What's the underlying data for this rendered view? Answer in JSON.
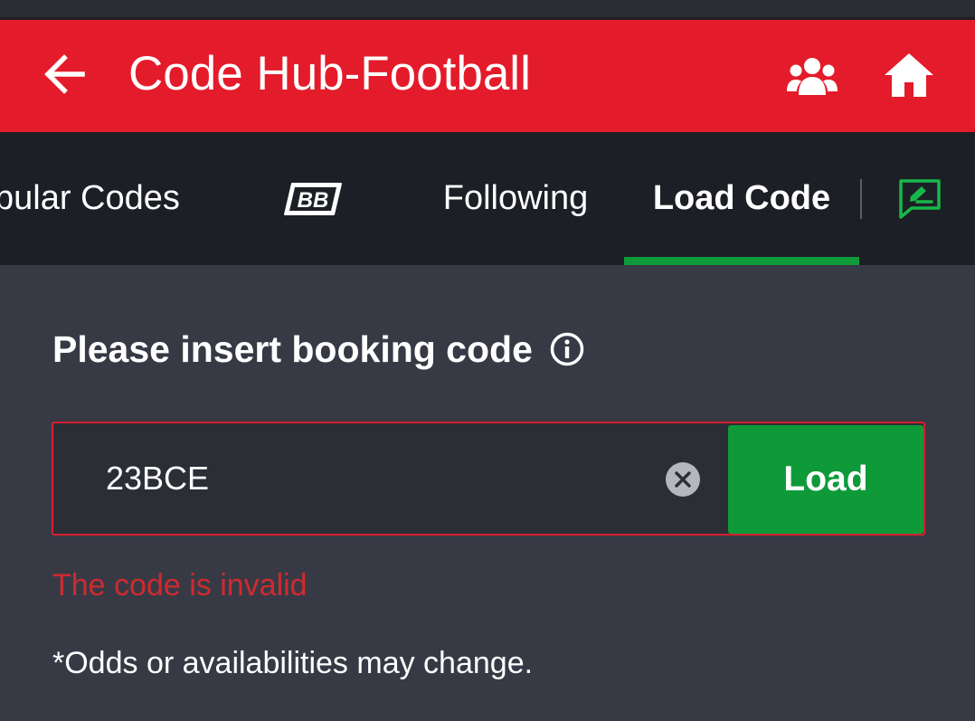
{
  "app_bar": {
    "title": "Code Hub-Football",
    "back_icon": "arrow-left-icon",
    "users_icon": "users-icon",
    "home_icon": "home-icon",
    "color": "#e41b2a"
  },
  "tabs": {
    "items": [
      {
        "label": "pular Codes"
      },
      {
        "label": "BB"
      },
      {
        "label": "Following"
      },
      {
        "label": "Load Code"
      }
    ],
    "active": "Load Code",
    "active_color": "#0f9a3a",
    "create_icon": "edit-message-icon"
  },
  "main": {
    "heading": "Please insert booking code",
    "info_icon": "info-icon",
    "input_value": "23BCE",
    "clear_icon": "clear-circle-icon",
    "load_label": "Load",
    "error": "The code is invalid",
    "note": "*Odds or availabilities may change."
  },
  "colors": {
    "background": "#373a45",
    "tab_bar": "#1d1f26",
    "error": "#cf2a2f",
    "button": "#0f9a3a"
  }
}
